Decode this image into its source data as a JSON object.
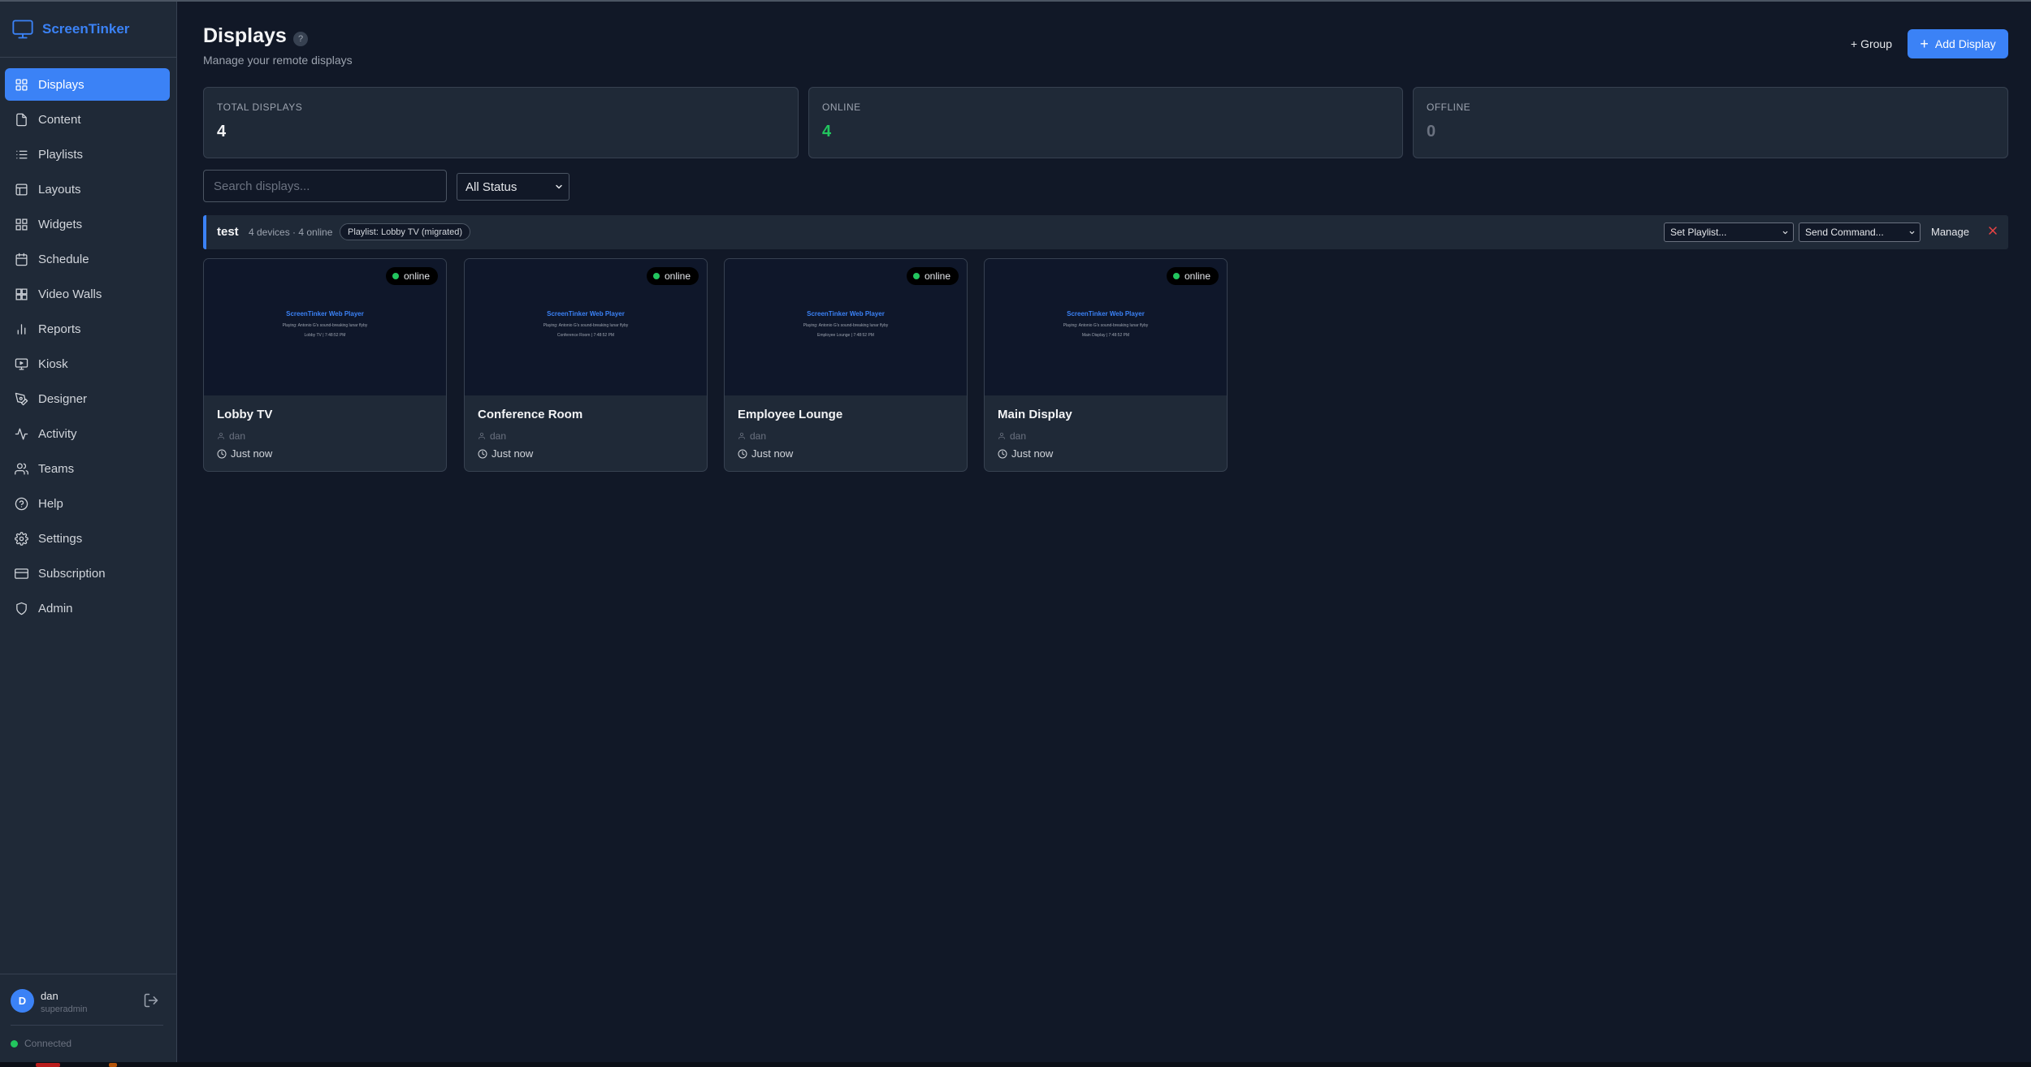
{
  "app": {
    "name": "ScreenTinker"
  },
  "sidebar": {
    "items": [
      {
        "label": "Displays",
        "icon": "grid-icon"
      },
      {
        "label": "Content",
        "icon": "file-icon"
      },
      {
        "label": "Playlists",
        "icon": "list-icon"
      },
      {
        "label": "Layouts",
        "icon": "layout-icon"
      },
      {
        "label": "Widgets",
        "icon": "widgets-icon"
      },
      {
        "label": "Schedule",
        "icon": "calendar-icon"
      },
      {
        "label": "Video Walls",
        "icon": "video-wall-icon"
      },
      {
        "label": "Reports",
        "icon": "bar-chart-icon"
      },
      {
        "label": "Kiosk",
        "icon": "kiosk-icon"
      },
      {
        "label": "Designer",
        "icon": "pen-icon"
      },
      {
        "label": "Activity",
        "icon": "activity-icon"
      },
      {
        "label": "Teams",
        "icon": "users-icon"
      },
      {
        "label": "Help",
        "icon": "help-circle-icon"
      },
      {
        "label": "Settings",
        "icon": "gear-icon"
      },
      {
        "label": "Subscription",
        "icon": "credit-card-icon"
      },
      {
        "label": "Admin",
        "icon": "shield-icon"
      }
    ],
    "active": "Displays"
  },
  "user": {
    "initial": "D",
    "name": "dan",
    "role": "superadmin"
  },
  "connection": {
    "status": "Connected",
    "color": "#22c55e"
  },
  "header": {
    "title": "Displays",
    "help": "?",
    "subtitle": "Manage your remote displays",
    "group_button": "+ Group",
    "add_button": "Add Display"
  },
  "stats": [
    {
      "label": "TOTAL DISPLAYS",
      "value": "4",
      "color": "#f3f4f6"
    },
    {
      "label": "ONLINE",
      "value": "4",
      "color": "#22c55e"
    },
    {
      "label": "OFFLINE",
      "value": "0",
      "color": "#6b7280"
    }
  ],
  "filters": {
    "search_placeholder": "Search displays...",
    "status_selected": "All Status"
  },
  "group": {
    "name": "test",
    "meta": "4 devices · 4 online",
    "playlist_pill": "Playlist: Lobby TV (migrated)",
    "set_playlist": "Set Playlist...",
    "send_command": "Send Command...",
    "manage": "Manage"
  },
  "displays": [
    {
      "name": "Lobby TV",
      "status": "online",
      "owner": "dan",
      "last_seen": "Just now",
      "preview_title": "ScreenTinker Web Player",
      "preview_line1": "Playing: Antonio G's sound-breaking lunar flyby",
      "preview_line2": "Lobby TV | 7:48:52 PM"
    },
    {
      "name": "Conference Room",
      "status": "online",
      "owner": "dan",
      "last_seen": "Just now",
      "preview_title": "ScreenTinker Web Player",
      "preview_line1": "Playing: Antonio G's sound-breaking lunar flyby",
      "preview_line2": "Conference Room | 7:48:52 PM"
    },
    {
      "name": "Employee Lounge",
      "status": "online",
      "owner": "dan",
      "last_seen": "Just now",
      "preview_title": "ScreenTinker Web Player",
      "preview_line1": "Playing: Antonio G's sound-breaking lunar flyby",
      "preview_line2": "Employee Lounge | 7:48:52 PM"
    },
    {
      "name": "Main Display",
      "status": "online",
      "owner": "dan",
      "last_seen": "Just now",
      "preview_title": "ScreenTinker Web Player",
      "preview_line1": "Playing: Antonio G's sound-breaking lunar flyby",
      "preview_line2": "Main Display | 7:48:52 PM"
    }
  ],
  "colors": {
    "accent": "#3b82f6",
    "background": "#111827",
    "panel": "#1f2937",
    "online": "#22c55e",
    "danger": "#ef4444"
  }
}
